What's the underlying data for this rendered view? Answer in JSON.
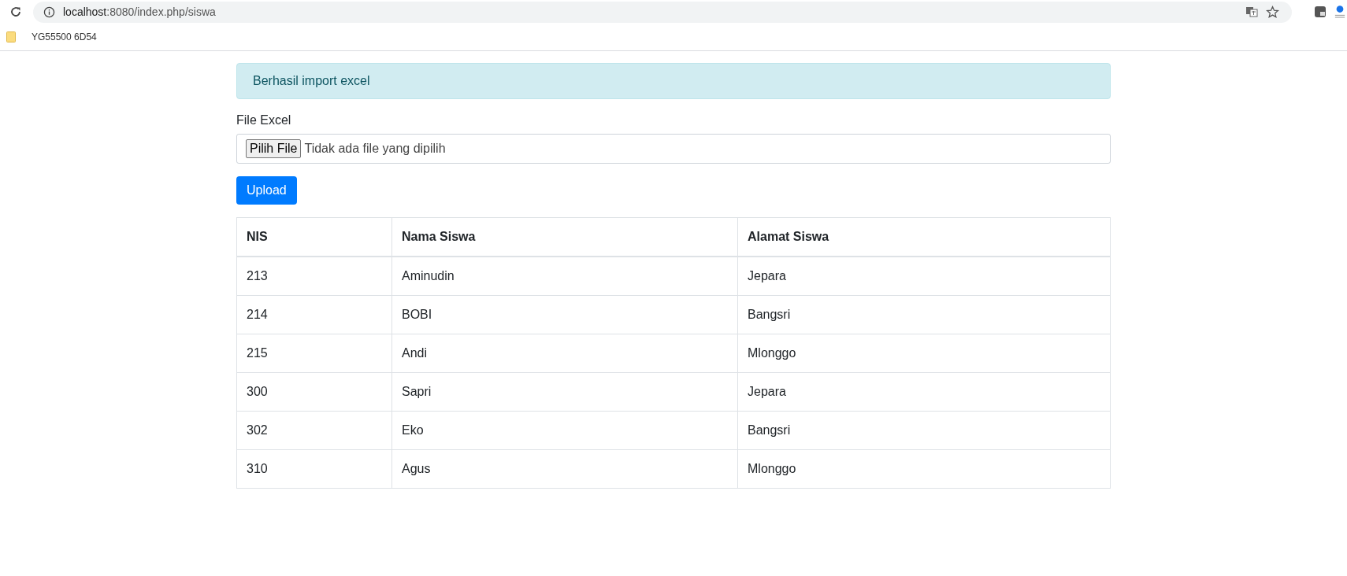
{
  "browser": {
    "url_host": "localhost",
    "url_path": ":8080/index.php/siswa",
    "bookmarks": [
      "YG55500 6D54"
    ]
  },
  "alert": {
    "text": "Berhasil import excel"
  },
  "form": {
    "label": "File Excel",
    "file_button": "Pilih File",
    "file_status": "Tidak ada file yang dipilih",
    "submit": "Upload"
  },
  "table": {
    "columns": [
      "NIS",
      "Nama Siswa",
      "Alamat Siswa"
    ],
    "rows": [
      [
        "213",
        "Aminudin",
        "Jepara"
      ],
      [
        "214",
        "BOBI",
        "Bangsri"
      ],
      [
        "215",
        "Andi",
        "Mlonggo"
      ],
      [
        "300",
        "Sapri",
        "Jepara"
      ],
      [
        "302",
        "Eko",
        "Bangsri"
      ],
      [
        "310",
        "Agus",
        "Mlonggo"
      ]
    ]
  }
}
